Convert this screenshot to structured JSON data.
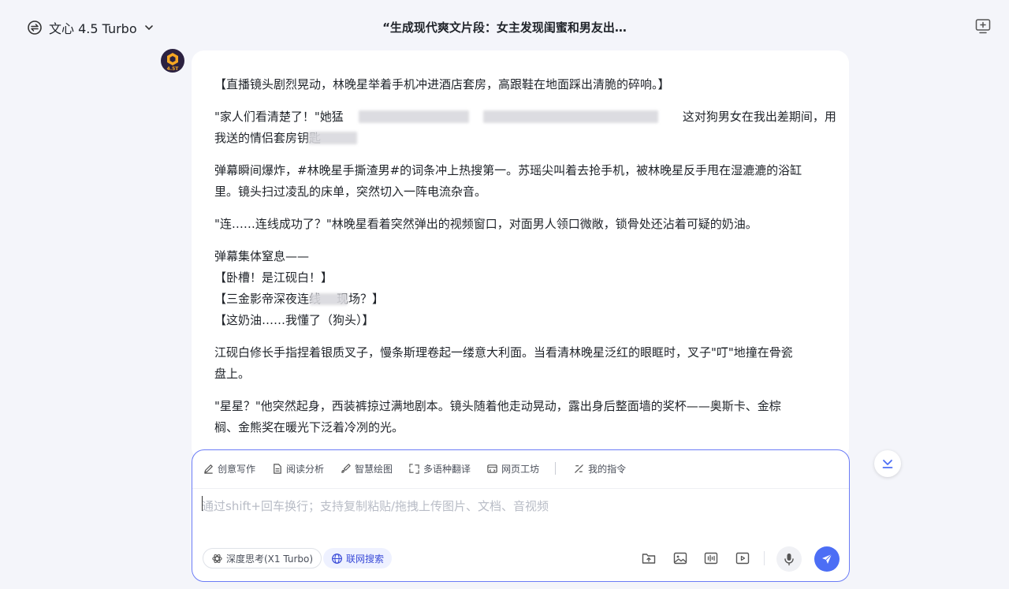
{
  "header": {
    "model_name": "文心 4.5 Turbo",
    "conversation_title": "“生成现代爽文片段：女主发现闺蜜和男友出…",
    "avatar_badge": "4.5T"
  },
  "answer": {
    "p1": "【直播镜头剧烈晃动，林晚星举着手机冲进酒店套房，高跟鞋在地面踩出清脆的碎响。】",
    "p2_l1_a": "\"家人们看清楚了！\"她猛",
    "p2_l1_b": "这对狗男女在我出差期间，用",
    "p2_l2": "我送的情侣套房钥匙",
    "p3_l1": "弹幕瞬间爆炸，#林晚星手撕渣男#的词条冲上热搜第一。苏瑶尖叫着去抢手机，被林晚星反手甩在湿漉漉的浴缸",
    "p3_l2": "里。镜头扫过凌乱的床单，突然切入一阵电流杂音。",
    "p4": "\"连……连线成功了？\"林晚星看着突然弹出的视频窗口，对面男人领口微敞，锁骨处还沾着可疑的奶油。",
    "p5_l1": "弹幕集体窒息——",
    "p5_l2": "【卧槽！是江砚白！】",
    "p5_l3_a": "【三金影帝深夜连线",
    "p5_l3_b": "现场？】",
    "p5_l4": "【这奶油……我懂了（狗头）】",
    "p6_l1": "江砚白修长手指捏着银质叉子，慢条斯理卷起一缕意大利面。当看清林晚星泛红的眼眶时，叉子\"叮\"地撞在骨瓷",
    "p6_l2": "盘上。",
    "p7_l1": "\"星星？\"他突然起身，西装裤掠过满地剧本。镜头随着他走动晃动，露出身后整面墙的奖杯——奥斯卡、金棕",
    "p7_l2": "榈、金熊奖在暖光下泛着冷冽的光。"
  },
  "composer": {
    "tools": [
      "创意写作",
      "阅读分析",
      "智慧绘图",
      "多语种翻译",
      "网页工坊",
      "我的指令"
    ],
    "placeholder": "通过shift+回车换行；支持复制粘贴/拖拽上传图片、文档、音视频",
    "deep_think_label": "深度思考(X1 Turbo)",
    "web_search_label": "联网搜索"
  },
  "colors": {
    "accent": "#4c6ef5",
    "composer_border": "#6b7cf6",
    "background": "#f4f5fa"
  }
}
